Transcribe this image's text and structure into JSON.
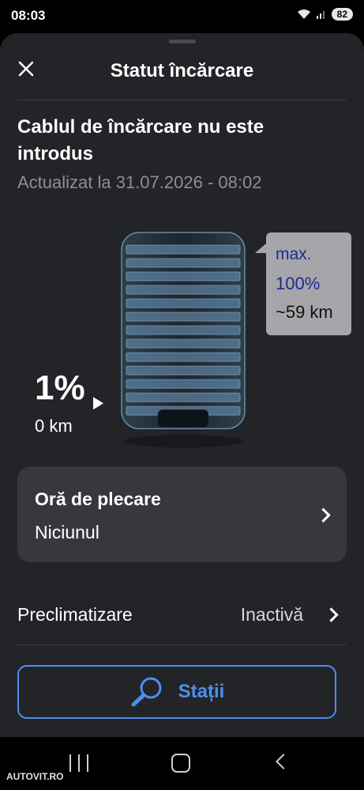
{
  "status_bar": {
    "time": "08:03",
    "battery": "82"
  },
  "header": {
    "title": "Statut încărcare"
  },
  "charge": {
    "cable_status": "Cablul de încărcare nu este introdus",
    "updated": "Actualizat la 31.07.2026 - 08:02",
    "current_percent": "1%",
    "current_range": "0 km",
    "bubble_max": "max.",
    "bubble_percent": "100%",
    "bubble_range": "~59 km"
  },
  "departure": {
    "title": "Oră de plecare",
    "value": "Niciunul"
  },
  "preclimatization": {
    "label": "Preclimatizare",
    "value": "Inactivă"
  },
  "stations_button": {
    "label": "Stații"
  },
  "watermark": "AUTOVIT.RO",
  "colors": {
    "accent": "#4d8ff0",
    "sheet": "#232428",
    "card": "#37383d",
    "bubble": "#a6a6aa"
  }
}
